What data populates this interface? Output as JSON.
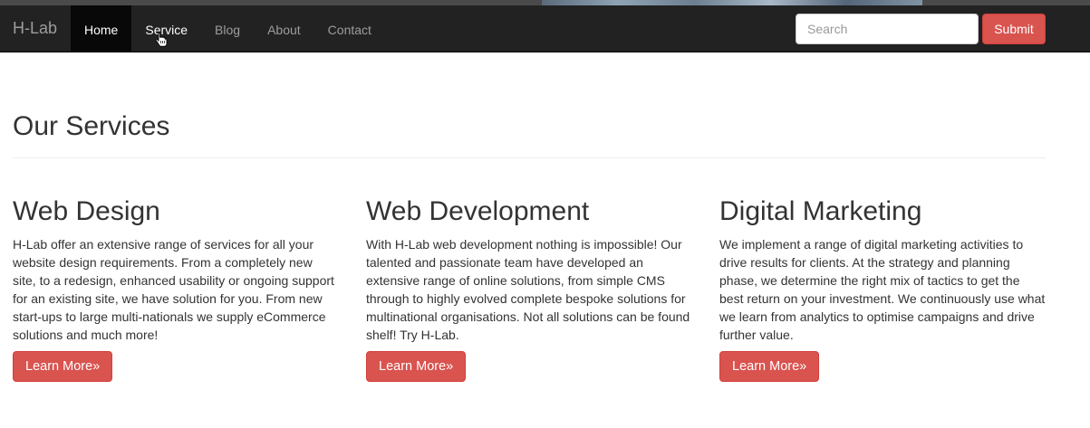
{
  "navbar": {
    "brand": "H-Lab",
    "items": [
      {
        "label": "Home",
        "active": true
      },
      {
        "label": "Service",
        "active": false
      },
      {
        "label": "Blog",
        "active": false
      },
      {
        "label": "About",
        "active": false
      },
      {
        "label": "Contact",
        "active": false
      }
    ],
    "search": {
      "placeholder": "Search",
      "value": ""
    },
    "submit_label": "Submit"
  },
  "main": {
    "title": "Our Services",
    "services": [
      {
        "heading": "Web Design",
        "text": "H-Lab offer an extensive range of services for all your website design requirements. From a completely new site, to a redesign, enhanced usability or ongoing support for an existing site, we have solution for you. From new start-ups to large multi-nationals we supply eCommerce solutions and much more!",
        "button": "Learn More»"
      },
      {
        "heading": "Web Development",
        "text": "With H-Lab web development nothing is impossible! Our talented and passionate team have developed an extensive range of online solutions, from simple CMS through to highly evolved complete bespoke solutions for multinational organisations. Not all solutions can be found shelf! Try H-Lab.",
        "button": "Learn More»"
      },
      {
        "heading": "Digital Marketing",
        "text": "We implement a range of digital marketing activities to drive results for clients. At the strategy and planning phase, we determine the right mix of tactics to get the best return on your investment. We continuously use what we learn from analytics to optimise campaigns and drive further value.",
        "button": "Learn More»"
      }
    ]
  },
  "colors": {
    "navbar_bg": "#222222",
    "active_bg": "#080808",
    "nav_text": "#9d9d9d",
    "danger": "#d9534f"
  },
  "icons": {
    "cursor": "hand-pointer-icon"
  }
}
